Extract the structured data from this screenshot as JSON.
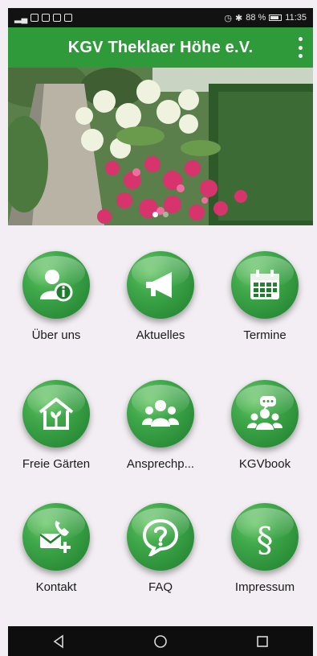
{
  "statusbar": {
    "battery_percent": "88 %",
    "time": "11:35",
    "left_icons": [
      "signal-icon",
      "whatsapp-icon",
      "instagram-icon",
      "flipboard-icon",
      "gallery-icon"
    ],
    "right_icons": [
      "alarm-icon",
      "bluetooth-icon",
      "battery-icon"
    ]
  },
  "appbar": {
    "title": "KGV Theklaer Höhe e.V.",
    "menu_icon": "more-vert-icon",
    "color": "#2f9a3a"
  },
  "carousel": {
    "pages": 2,
    "active_index": 0
  },
  "tiles": [
    {
      "label": "Über uns",
      "icon": "info-person-icon"
    },
    {
      "label": "Aktuelles",
      "icon": "megaphone-icon"
    },
    {
      "label": "Termine",
      "icon": "calendar-icon"
    },
    {
      "label": "Freie Gärten",
      "icon": "garden-house-icon"
    },
    {
      "label": "Ansprechp...",
      "icon": "contacts-group-icon"
    },
    {
      "label": "KGVbook",
      "icon": "chat-group-icon"
    },
    {
      "label": "Kontakt",
      "icon": "phone-mail-icon"
    },
    {
      "label": "FAQ",
      "icon": "question-bubble-icon"
    },
    {
      "label": "Impressum",
      "icon": "paragraph-icon"
    }
  ],
  "navbar": {
    "buttons": [
      "back-icon",
      "home-icon",
      "recents-icon"
    ]
  }
}
